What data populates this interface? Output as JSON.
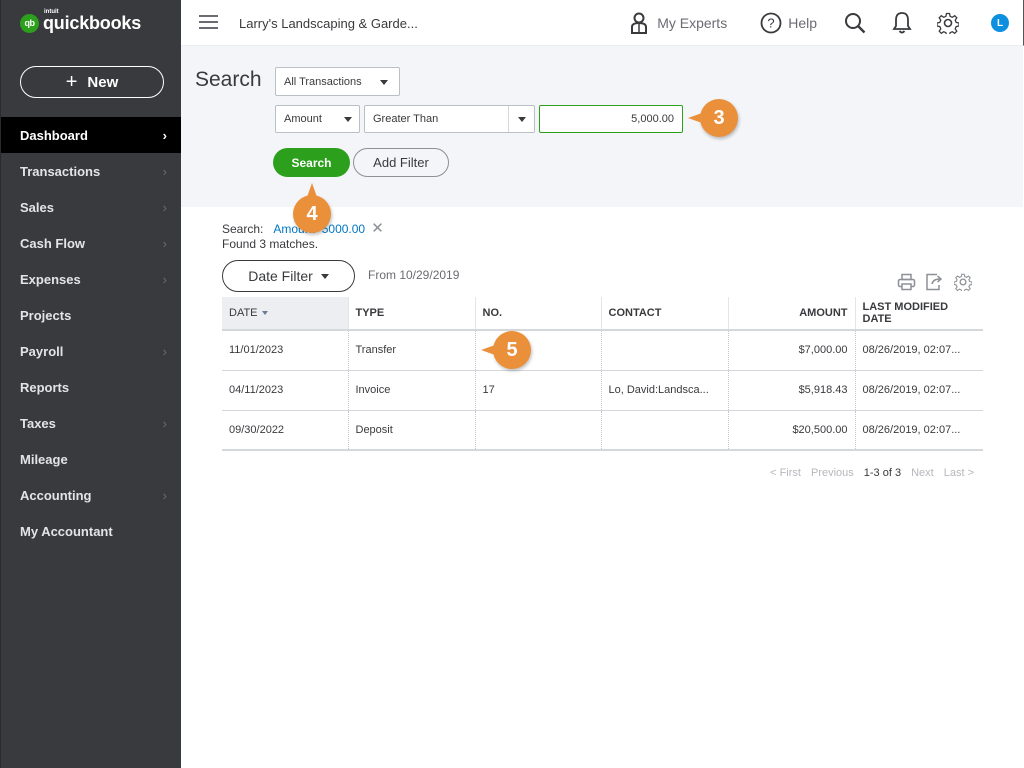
{
  "app": {
    "logo_small": "intuit",
    "logo_text": "quickbooks",
    "logo_badge": "qb"
  },
  "sidebar": {
    "new_button": "New",
    "new_icon": "plus-icon",
    "items": [
      {
        "label": "Dashboard",
        "active": true,
        "chevron": true
      },
      {
        "label": "Transactions",
        "chevron": true
      },
      {
        "label": "Sales",
        "chevron": true
      },
      {
        "label": "Cash Flow",
        "chevron": true
      },
      {
        "label": "Expenses",
        "chevron": true
      },
      {
        "label": "Projects",
        "chevron": false
      },
      {
        "label": "Payroll",
        "chevron": true
      },
      {
        "label": "Reports",
        "chevron": false
      },
      {
        "label": "Taxes",
        "chevron": true
      },
      {
        "label": "Mileage",
        "chevron": false
      },
      {
        "label": "Accounting",
        "chevron": true
      },
      {
        "label": "My Accountant",
        "chevron": false
      }
    ]
  },
  "topbar": {
    "company_name": "Larry's Landscaping & Garde...",
    "my_experts": "My Experts",
    "help": "Help",
    "avatar_initial": "L"
  },
  "search": {
    "title": "Search",
    "transaction_type": "All Transactions",
    "filter_field": "Amount",
    "filter_operator": "Greater Than",
    "filter_value": "5,000.00",
    "search_button": "Search",
    "add_filter_button": "Add Filter"
  },
  "results": {
    "search_label": "Search:",
    "search_tag": "Amount>5000.00",
    "found_text": "Found 3 matches.",
    "date_filter_button": "Date Filter",
    "from_text": "From 10/29/2019",
    "columns": [
      "DATE",
      "TYPE",
      "NO.",
      "CONTACT",
      "AMOUNT",
      "LAST MODIFIED DATE"
    ],
    "rows": [
      {
        "date": "11/01/2023",
        "type": "Transfer",
        "no": "",
        "contact": "",
        "amount": "$7,000.00",
        "modified": "08/26/2019, 02:07..."
      },
      {
        "date": "04/11/2023",
        "type": "Invoice",
        "no": "17",
        "contact": "Lo, David:Landsca...",
        "amount": "$5,918.43",
        "modified": "08/26/2019, 02:07..."
      },
      {
        "date": "09/30/2022",
        "type": "Deposit",
        "no": "",
        "contact": "",
        "amount": "$20,500.00",
        "modified": "08/26/2019, 02:07..."
      }
    ],
    "pager": {
      "first": "< First",
      "previous": "Previous",
      "current": "1-3 of 3",
      "next": "Next",
      "last": "Last >"
    }
  },
  "callouts": {
    "c3": "3",
    "c4": "4",
    "c5": "5",
    "color": "#ea8f3a"
  },
  "colors": {
    "brand_green": "#2ca01c",
    "link_blue": "#0077c5",
    "sidebar_bg": "#393a3d"
  }
}
